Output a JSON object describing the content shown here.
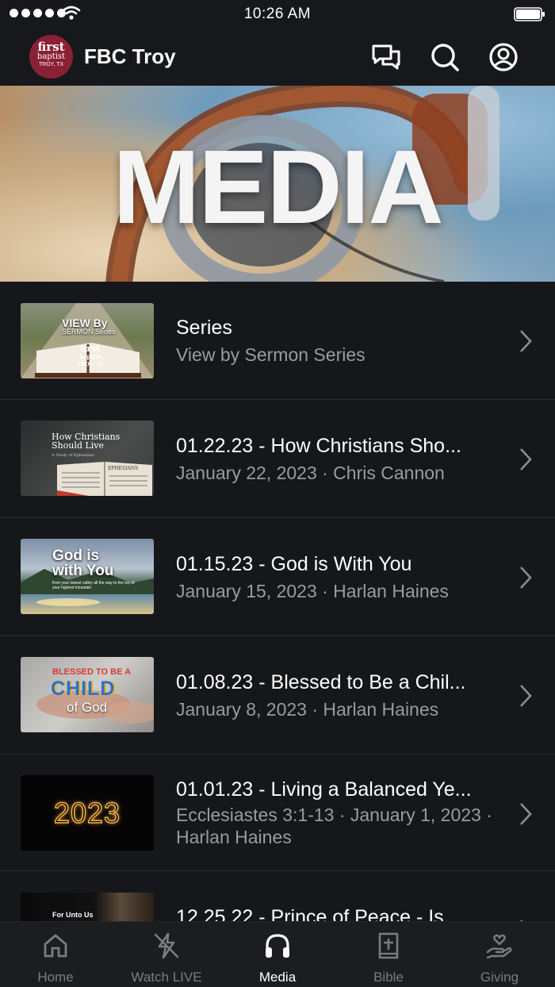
{
  "status_bar": {
    "time": "10:26 AM"
  },
  "header": {
    "logo": {
      "line1": "first",
      "line2": "baptist",
      "line3": "TROY, TX"
    },
    "title": "FBC Troy",
    "icons": [
      "chat-icon",
      "search-icon",
      "profile-icon"
    ]
  },
  "hero": {
    "title": "MEDIA"
  },
  "list": [
    {
      "title": "Series",
      "subtitle": "View by Sermon Series",
      "thumb": {
        "line1": "VIEW By",
        "line2": "SERMON Series",
        "logo1": "first",
        "logo2": "baptist",
        "logo3": "TROY, TX"
      }
    },
    {
      "title": "01.22.23 - How Christians Sho...",
      "subtitle": "January 22, 2023 · Chris Cannon",
      "thumb": {
        "line1": "How Christians",
        "line2": "Should Live",
        "line3": "A Study of Ephesians",
        "book": "EPHESIANS"
      }
    },
    {
      "title": "01.15.23 - God is With You",
      "subtitle": "January 15, 2023 · Harlan Haines",
      "thumb": {
        "line1": "God is",
        "line2": "with You",
        "line3": "from your lowest valley all the way to the top of your highest mountain"
      }
    },
    {
      "title": "01.08.23 - Blessed to Be a Chil...",
      "subtitle": "January 8, 2023 · Harlan Haines",
      "thumb": {
        "line1": "BLESSED TO BE A",
        "line2": "CHILD",
        "line3": "of God"
      }
    },
    {
      "title": "01.01.23 - Living a Balanced Ye...",
      "subtitle": "Ecclesiastes 3:1-13 · January 1, 2023 · Harlan Haines",
      "thumb": {
        "line1": "2023"
      }
    },
    {
      "title": "12.25.22 - Prince of Peace - Is...",
      "subtitle": "",
      "thumb": {
        "line1": "For Unto Us"
      }
    }
  ],
  "tabs": [
    {
      "label": "Home",
      "icon": "home-icon",
      "active": false
    },
    {
      "label": "Watch LIVE",
      "icon": "live-icon",
      "active": false
    },
    {
      "label": "Media",
      "icon": "headphones-icon",
      "active": true
    },
    {
      "label": "Bible",
      "icon": "bible-icon",
      "active": false
    },
    {
      "label": "Giving",
      "icon": "giving-icon",
      "active": false
    }
  ]
}
